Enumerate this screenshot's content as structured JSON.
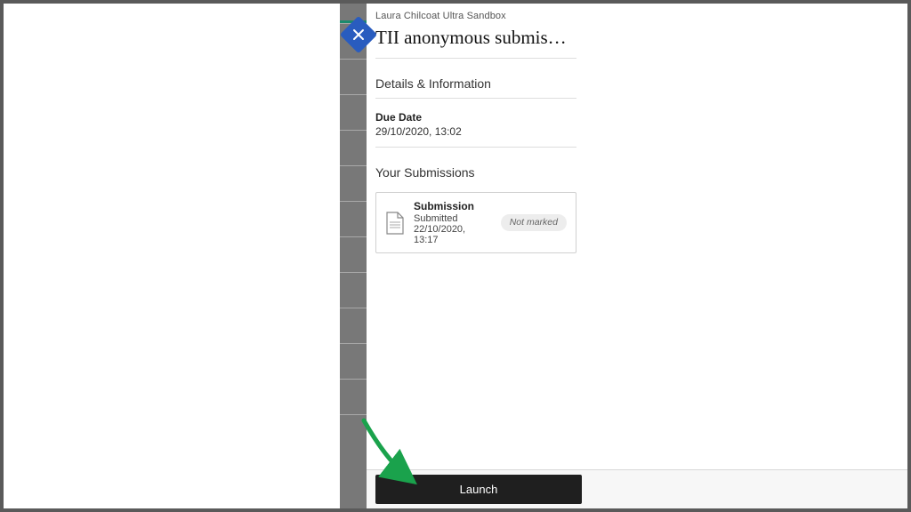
{
  "header": {
    "course_label": "Laura Chilcoat Ultra Sandbox",
    "title": "TII anonymous submis…"
  },
  "details": {
    "section_title": "Details & Information",
    "due_label": "Due Date",
    "due_value": "29/10/2020, 13:02"
  },
  "submissions": {
    "section_title": "Your Submissions",
    "items": [
      {
        "title": "Submission",
        "subtitle": "Submitted 22/10/2020, 13:17",
        "status": "Not marked"
      }
    ]
  },
  "footer": {
    "launch_label": "Launch"
  }
}
